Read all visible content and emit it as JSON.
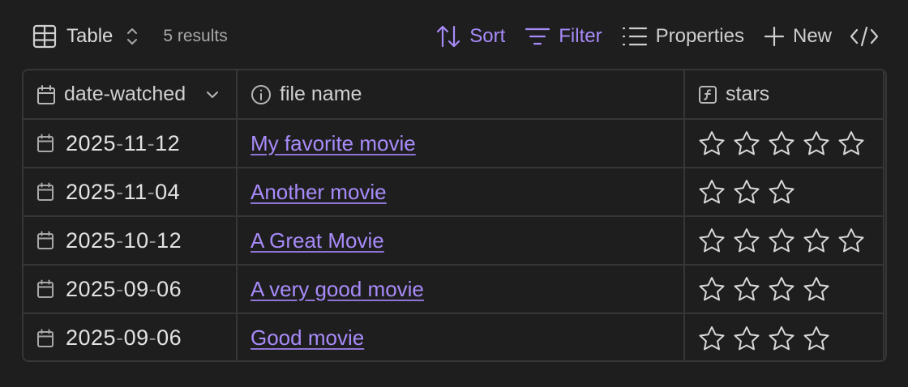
{
  "toolbar": {
    "view_label": "Table",
    "results_text": "5 results",
    "sort_label": "Sort",
    "filter_label": "Filter",
    "properties_label": "Properties",
    "new_label": "New"
  },
  "table": {
    "columns": [
      {
        "label": "date-watched",
        "icon": "calendar-icon"
      },
      {
        "label": "file name",
        "icon": "info-icon"
      },
      {
        "label": "stars",
        "icon": "formula-icon"
      }
    ],
    "rows": [
      {
        "date": {
          "y": "2025",
          "m": "11",
          "d": "12"
        },
        "name": "My favorite movie",
        "stars": 5
      },
      {
        "date": {
          "y": "2025",
          "m": "11",
          "d": "04"
        },
        "name": "Another movie",
        "stars": 3
      },
      {
        "date": {
          "y": "2025",
          "m": "10",
          "d": "12"
        },
        "name": "A Great Movie",
        "stars": 5
      },
      {
        "date": {
          "y": "2025",
          "m": "09",
          "d": "06"
        },
        "name": "A very good movie",
        "stars": 4
      },
      {
        "date": {
          "y": "2025",
          "m": "09",
          "d": "06"
        },
        "name": "Good movie",
        "stars": 4
      }
    ]
  },
  "colors": {
    "accent": "#a88bfa",
    "background": "#1e1e1e",
    "border": "#363636",
    "text": "#dadada"
  }
}
